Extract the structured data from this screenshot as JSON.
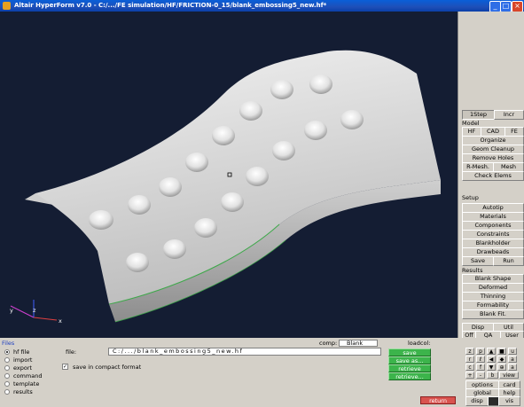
{
  "window": {
    "title": "Altair HyperForm v7.0 - C:/.../FE simulation/HF/FRICTION-0_15/blank_embossing5_new.hf*"
  },
  "colors": {
    "viewport_bg": "#141d33",
    "button_green": "#3cb44b",
    "button_red": "#d9534f",
    "titlebar": "#0b3fa8"
  },
  "viewport": {
    "axis": {
      "x": "x",
      "y": "y",
      "z": "z"
    }
  },
  "right_panel": {
    "top_buttons": [
      "1Step",
      "Incr"
    ],
    "model_label": "Model",
    "model_tabs": [
      "HF",
      "CAD",
      "FE"
    ],
    "model_items": [
      "Organize",
      "Geom Cleanup",
      "Remove Holes"
    ],
    "mesh_row": [
      "R-Mesh.",
      "Mesh"
    ],
    "check_elems": "Check Elems",
    "setup_label": "Setup",
    "setup_items": [
      "Autotip",
      "Materials",
      "Components",
      "Constraints",
      "Blankholder",
      "Drawbeads"
    ],
    "setup_row": [
      "Save",
      "Run"
    ],
    "results_label": "Results",
    "results_items": [
      "Blank Shape",
      "Deformed",
      "Thinning",
      "Formability",
      "Blank Fit."
    ],
    "disp_row": [
      "Disp",
      "Util"
    ],
    "bottom_row": [
      "Off",
      "QA",
      "User"
    ]
  },
  "bottom_panel": {
    "files_label": "Files",
    "comp_label": "comp:",
    "comp_value": "Blank",
    "loadcol_label": "loadcol:",
    "radio_options": [
      "hf file",
      "import",
      "export",
      "command",
      "template",
      "results"
    ],
    "selected_radio": "hf file",
    "file_label": "file:",
    "file_value": "C:/.../blank_embossing5_new.hf",
    "compact_label": "save in compact format",
    "compact_checked": true,
    "actions": [
      "save",
      "save as...",
      "retrieve",
      "retrieve..."
    ],
    "return_label": "return",
    "view_pad": [
      [
        "z",
        "p",
        "▲",
        "■",
        "u"
      ],
      [
        "r",
        "ℓ",
        "◀",
        "◆",
        "a"
      ],
      [
        "c",
        "f",
        "▼",
        "⊕",
        "a"
      ]
    ],
    "view_row": [
      "+",
      "-",
      "b",
      "view"
    ],
    "options_label": "options",
    "card_label": "card",
    "global_label": "global",
    "help_label": "help",
    "disp_label": "disp",
    "vis_label": "vis"
  }
}
